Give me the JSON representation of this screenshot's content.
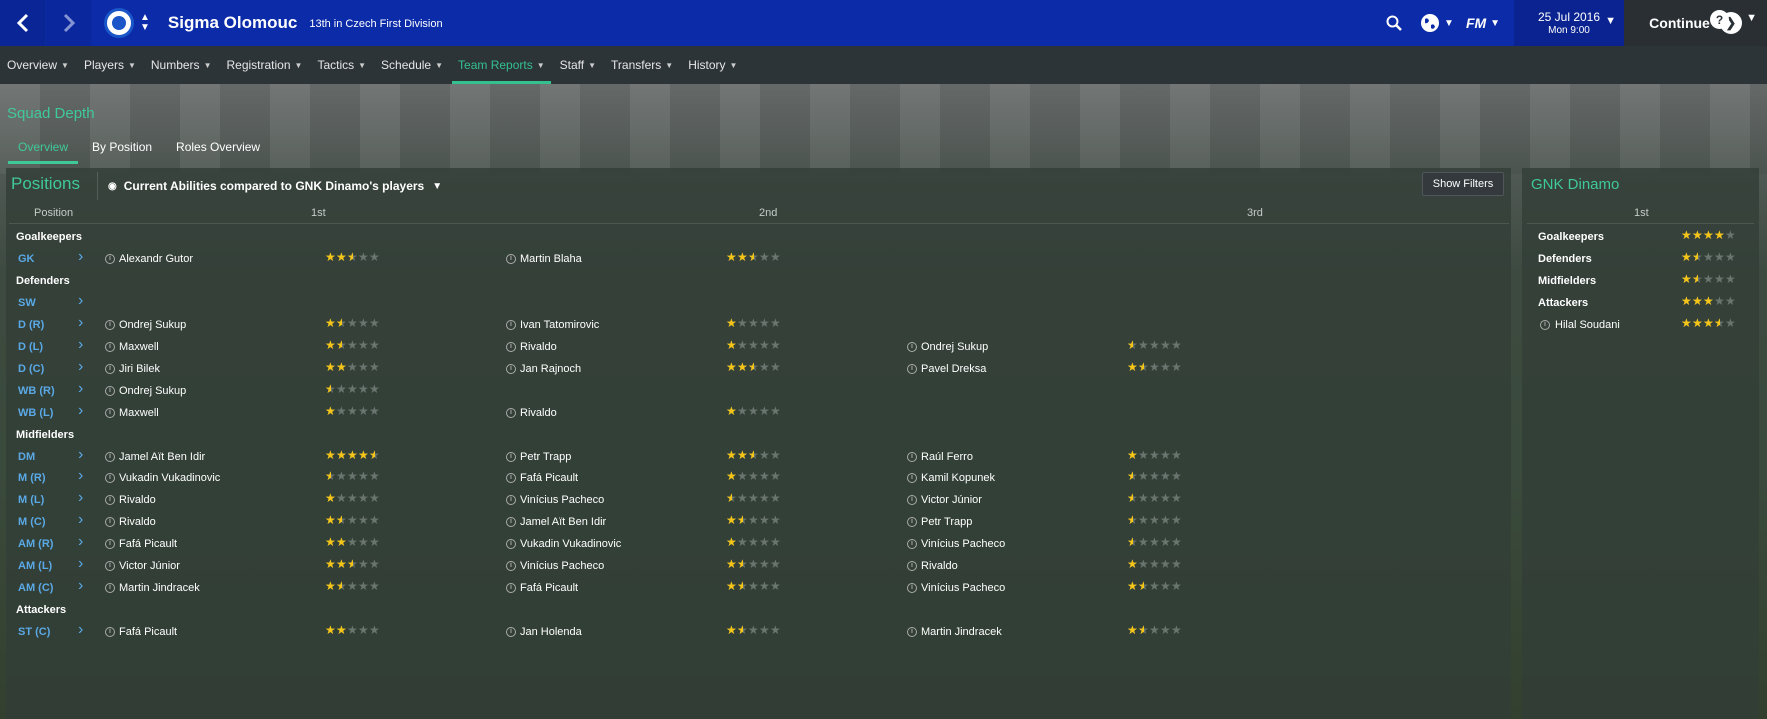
{
  "header": {
    "club_name": "Sigma Olomouc",
    "club_sub": "13th in Czech First Division",
    "date": "25 Jul 2016",
    "time": "Mon 9:00",
    "continue_label": "Continue",
    "fm_label": "FM"
  },
  "menu": [
    "Overview",
    "Players",
    "Numbers",
    "Registration",
    "Tactics",
    "Schedule",
    "Team Reports",
    "Staff",
    "Transfers",
    "History"
  ],
  "menu_active": "Team Reports",
  "page": {
    "title": "Squad Depth",
    "tabs": [
      "Overview",
      "By Position",
      "Roles Overview"
    ],
    "active_tab": "Overview"
  },
  "positions": {
    "title": "Positions",
    "filter_label": "Current Abilities compared to GNK Dinamo's players",
    "show_filters": "Show Filters",
    "columns": [
      "Position",
      "1st",
      "2nd",
      "3rd"
    ],
    "rows": [
      {
        "type": "cat",
        "label": "Goalkeepers"
      },
      {
        "type": "pos",
        "pos": "GK",
        "players": [
          {
            "name": "Alexandr Gutor",
            "stars": 2.5
          },
          {
            "name": "Martin Blaha",
            "stars": 2.5
          }
        ]
      },
      {
        "type": "cat",
        "label": "Defenders"
      },
      {
        "type": "pos",
        "pos": "SW",
        "players": []
      },
      {
        "type": "pos",
        "pos": "D (R)",
        "players": [
          {
            "name": "Ondrej Sukup",
            "stars": 1.5
          },
          {
            "name": "Ivan Tatomirovic",
            "stars": 1
          }
        ]
      },
      {
        "type": "pos",
        "pos": "D (L)",
        "players": [
          {
            "name": "Maxwell",
            "stars": 1.5
          },
          {
            "name": "Rivaldo",
            "stars": 1
          },
          {
            "name": "Ondrej Sukup",
            "stars": 0.5
          }
        ]
      },
      {
        "type": "pos",
        "pos": "D (C)",
        "players": [
          {
            "name": "Jiri Bilek",
            "stars": 2
          },
          {
            "name": "Jan Rajnoch",
            "stars": 2.5
          },
          {
            "name": "Pavel Dreksa",
            "stars": 1.5
          }
        ]
      },
      {
        "type": "pos",
        "pos": "WB (R)",
        "players": [
          {
            "name": "Ondrej Sukup",
            "stars": 0.5
          }
        ]
      },
      {
        "type": "pos",
        "pos": "WB (L)",
        "players": [
          {
            "name": "Maxwell",
            "stars": 1
          },
          {
            "name": "Rivaldo",
            "stars": 1
          }
        ]
      },
      {
        "type": "cat",
        "label": "Midfielders"
      },
      {
        "type": "pos",
        "pos": "DM",
        "players": [
          {
            "name": "Jamel Aït Ben Idir",
            "stars": 4.5
          },
          {
            "name": "Petr Trapp",
            "stars": 2.5
          },
          {
            "name": "Raúl Ferro",
            "stars": 1
          }
        ]
      },
      {
        "type": "pos",
        "pos": "M (R)",
        "players": [
          {
            "name": "Vukadin Vukadinovic",
            "stars": 0.5
          },
          {
            "name": "Fafá Picault",
            "stars": 1
          },
          {
            "name": "Kamil Kopunek",
            "stars": 0.5
          }
        ]
      },
      {
        "type": "pos",
        "pos": "M (L)",
        "players": [
          {
            "name": "Rivaldo",
            "stars": 1
          },
          {
            "name": "Vinícius Pacheco",
            "stars": 0.5
          },
          {
            "name": "Victor Júnior",
            "stars": 0.5
          }
        ]
      },
      {
        "type": "pos",
        "pos": "M (C)",
        "players": [
          {
            "name": "Rivaldo",
            "stars": 1.5
          },
          {
            "name": "Jamel Aït Ben Idir",
            "stars": 1.5
          },
          {
            "name": "Petr Trapp",
            "stars": 0.5
          }
        ]
      },
      {
        "type": "pos",
        "pos": "AM (R)",
        "players": [
          {
            "name": "Fafá Picault",
            "stars": 2
          },
          {
            "name": "Vukadin Vukadinovic",
            "stars": 1
          },
          {
            "name": "Vinícius Pacheco",
            "stars": 0.5
          }
        ]
      },
      {
        "type": "pos",
        "pos": "AM (L)",
        "players": [
          {
            "name": "Victor Júnior",
            "stars": 2.5
          },
          {
            "name": "Vinícius Pacheco",
            "stars": 1.5
          },
          {
            "name": "Rivaldo",
            "stars": 1
          }
        ]
      },
      {
        "type": "pos",
        "pos": "AM (C)",
        "players": [
          {
            "name": "Martin Jindracek",
            "stars": 1.5
          },
          {
            "name": "Fafá Picault",
            "stars": 1.5
          },
          {
            "name": "Vinícius Pacheco",
            "stars": 1.5
          }
        ]
      },
      {
        "type": "cat",
        "label": "Attackers"
      },
      {
        "type": "pos",
        "pos": "ST (C)",
        "players": [
          {
            "name": "Fafá Picault",
            "stars": 2
          },
          {
            "name": "Jan Holenda",
            "stars": 1.5
          },
          {
            "name": "Martin Jindracek",
            "stars": 1.5
          }
        ]
      }
    ]
  },
  "opponent": {
    "title": "GNK Dinamo",
    "column": "1st",
    "rows": [
      {
        "type": "cat",
        "label": "Goalkeepers",
        "stars": 4
      },
      {
        "type": "cat",
        "label": "Defenders",
        "stars": 1.5
      },
      {
        "type": "cat",
        "label": "Midfielders",
        "stars": 1.5
      },
      {
        "type": "cat",
        "label": "Attackers",
        "stars": 3
      },
      {
        "type": "player",
        "name": "Hilal Soudani",
        "stars": 3.5
      }
    ]
  }
}
